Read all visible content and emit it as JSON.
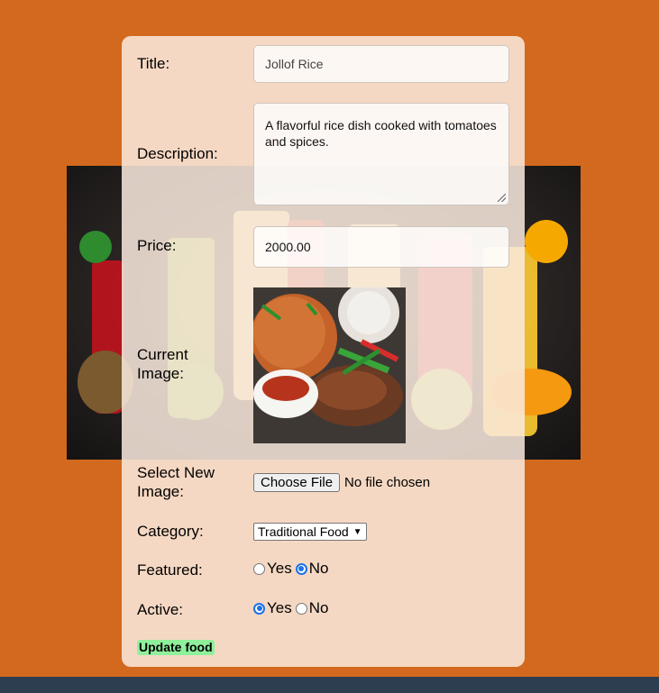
{
  "colors": {
    "page_background": "#d2691e",
    "card_background": "#faeade",
    "footer": "#2c3e50",
    "submit_button": "#8ff09b",
    "radio_checked": "#1a73e8"
  },
  "form": {
    "title_label": "Title:",
    "title_value": "Jollof Rice",
    "description_label": "Description:",
    "description_value": "A flavorful rice dish cooked with tomatoes and spices.",
    "price_label": "Price:",
    "price_value": "2000.00",
    "current_image_label": "Current Image:",
    "select_image_label": "Select New Image:",
    "file_button_label": "Choose File",
    "file_status": "No file chosen",
    "category_label": "Category:",
    "category_selected": "Traditional Food",
    "featured_label": "Featured:",
    "featured_yes": "Yes",
    "featured_no": "No",
    "featured_value": "No",
    "active_label": "Active:",
    "active_yes": "Yes",
    "active_no": "No",
    "active_value": "Yes",
    "submit_label": "Update food"
  },
  "icons": {
    "select_chevron": "chevron-down-icon",
    "resize_grip": "resize-grip-icon"
  }
}
